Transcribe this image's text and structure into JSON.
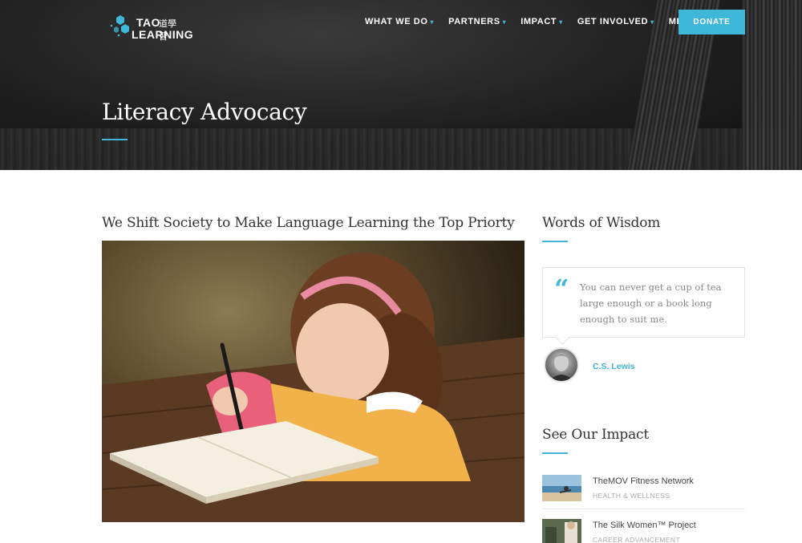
{
  "logo": {
    "line1": "TAO",
    "chinese": "道學習",
    "line2": "LEARNING",
    "brand_color": "#3fb7d8"
  },
  "nav": {
    "items": [
      {
        "label": "WHAT WE DO"
      },
      {
        "label": "PARTNERS"
      },
      {
        "label": "IMPACT"
      },
      {
        "label": "GET INVOLVED"
      },
      {
        "label": "MEDIA"
      }
    ],
    "caret_icon": "chevron-down-icon",
    "donate_label": "DONATE"
  },
  "hero": {
    "title": "Literacy Advocacy"
  },
  "main": {
    "heading": "We Shift Society to Make Language Learning the Top Priorty"
  },
  "sidebar": {
    "wisdom_heading": "Words of Wisdom",
    "quote": {
      "text": "You can never get a cup of tea large enough or a book long enough to suit me.",
      "author": "C.S. Lewis",
      "icon": "quote-icon"
    },
    "impact_heading": "See Our Impact",
    "impact_items": [
      {
        "title": "TheMOV Fitness Network",
        "category": "HEALTH & WELLNESS"
      },
      {
        "title": "The Silk Women™ Project",
        "category": "CAREER ADVANCEMENT"
      }
    ]
  },
  "colors": {
    "accent": "#3fb7d8",
    "hero_bg": "#1e1e1e"
  }
}
